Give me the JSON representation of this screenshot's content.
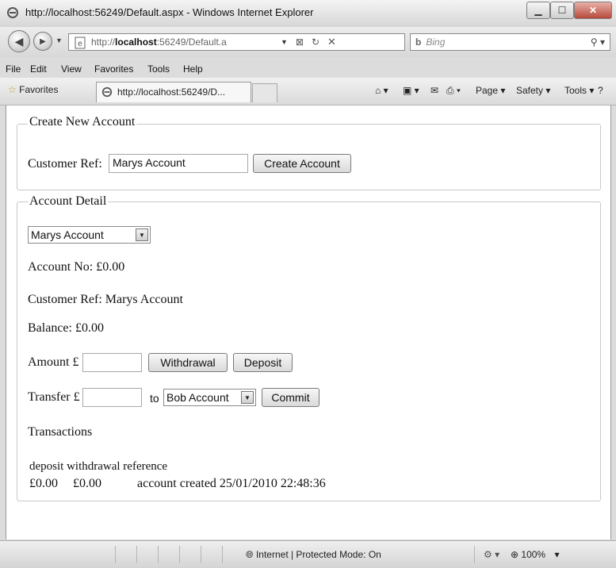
{
  "window": {
    "title": "http://localhost:56249/Default.aspx - Windows Internet Explorer"
  },
  "address_bar": {
    "url_prefix": "http://",
    "url_host": "localhost",
    "url_rest": ":56249/Default.a",
    "search_placeholder": "Bing"
  },
  "menu": {
    "items": [
      "File",
      "Edit",
      "View",
      "Favorites",
      "Tools",
      "Help"
    ]
  },
  "toolbar": {
    "favorites_label": "Favorites",
    "active_tab_label": "http://localhost:56249/D...",
    "commands": [
      "Page ▾",
      "Safety ▾",
      "Tools ▾"
    ]
  },
  "create_account": {
    "legend": "Create New Account",
    "customer_ref_label": "Customer Ref:",
    "customer_ref_value": "Marys Account",
    "create_button": "Create Account"
  },
  "account_detail": {
    "legend": "Account Detail",
    "selected_account": "Marys Account",
    "account_no": "Account No: £0.00",
    "customer_ref": "Customer Ref: Marys Account",
    "balance": "Balance: £0.00",
    "amount_label": "Amount £",
    "amount_value": "",
    "withdrawal_button": "Withdrawal",
    "deposit_button": "Deposit",
    "transfer_label": "Transfer £",
    "transfer_value": "",
    "to_label": "to",
    "transfer_target": "Bob Account",
    "commit_button": "Commit",
    "transactions_heading": "Transactions",
    "transactions_header": "deposit withdrawal reference",
    "transactions": [
      {
        "deposit": "£0.00",
        "withdrawal": "£0.00",
        "reference": "account created 25/01/2010 22:48:36"
      }
    ]
  },
  "status_bar": {
    "zone": "Internet | Protected Mode: On",
    "zoom": "100%"
  },
  "colors": {
    "close_button": "#b74a3c",
    "page_background": "#ffffff"
  }
}
